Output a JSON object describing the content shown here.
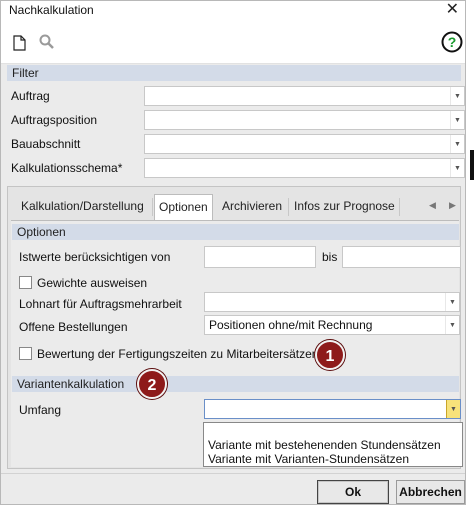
{
  "window": {
    "title": "Nachkalkulation"
  },
  "toolbar": {
    "new_icon": "document-icon",
    "search_icon": "search-icon",
    "help_icon": "help-icon",
    "help_glyph": "?",
    "help_color": "#1a9a2e"
  },
  "filter": {
    "header": "Filter",
    "auftrag_label": "Auftrag",
    "auftragsposition_label": "Auftragsposition",
    "bauabschnitt_label": "Bauabschnitt",
    "kalkulationsschema_label": "Kalkulationsschema*"
  },
  "tabs": {
    "kalkulation": "Kalkulation/Darstellung",
    "optionen": "Optionen",
    "archivieren": "Archivieren",
    "prognose": "Infos zur Prognose",
    "active": "Optionen"
  },
  "optionen": {
    "header": "Optionen",
    "istwerte_label": "Istwerte berücksichtigen von",
    "bis_label": "bis",
    "gewichte_label": "Gewichte ausweisen",
    "lohnart_label": "Lohnart für Auftragsmehrarbeit",
    "offene_label": "Offene Bestellungen",
    "offene_value": "Positionen ohne/mit Rechnung",
    "bewertung_label": "Bewertung der Fertigungszeiten zu Mitarbeitersätzen"
  },
  "variantenkalkulation": {
    "header": "Variantenkalkulation",
    "umfang_label": "Umfang",
    "options": [
      "Variante mit bestehenenden Stundensätzen",
      "Variante mit Varianten-Stundensätzen"
    ]
  },
  "callouts": {
    "one": "1",
    "two": "2",
    "color": "#8e1a1a"
  },
  "buttons": {
    "ok": "Ok",
    "cancel": "Abbrechen"
  }
}
